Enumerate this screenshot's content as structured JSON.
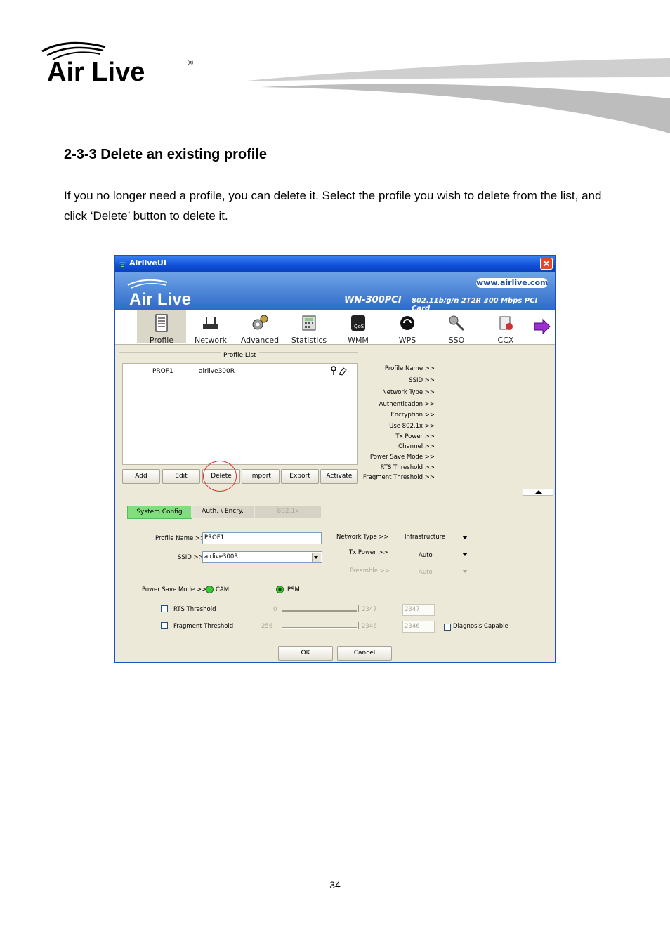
{
  "brand": {
    "name": "Air Live"
  },
  "section": {
    "heading": "2-3-3 Delete an existing profile",
    "body": "If you no longer need a profile, you can delete it. Select the profile you wish to delete from the list, and click ‘Delete’ button to delete it."
  },
  "page_number": "34",
  "window": {
    "title": "AirliveUI",
    "close_glyph": "✕",
    "banner": {
      "url": "www.airlive.com",
      "model": "WN-300PCI",
      "spec": "802.11b/g/n 2T2R 300 Mbps PCI Card"
    },
    "toolbar": [
      {
        "label": "Profile",
        "icon": "profile-icon"
      },
      {
        "label": "Network",
        "icon": "network-icon"
      },
      {
        "label": "Advanced",
        "icon": "advanced-icon"
      },
      {
        "label": "Statistics",
        "icon": "statistics-icon"
      },
      {
        "label": "WMM",
        "icon": "wmm-icon"
      },
      {
        "label": "WPS",
        "icon": "wps-icon"
      },
      {
        "label": "SSO",
        "icon": "sso-icon"
      },
      {
        "label": "CCX",
        "icon": "ccx-icon"
      }
    ],
    "profile_list": {
      "title": "Profile List",
      "rows": [
        {
          "name": "PROF1",
          "ssid": "airlive300R"
        }
      ],
      "buttons": [
        "Add",
        "Edit",
        "Delete",
        "Import",
        "Export",
        "Activate"
      ]
    },
    "profile_info": [
      "Profile Name >>",
      "SSID >>",
      "Network Type >>",
      "Authentication >>",
      "Encryption >>",
      "Use 802.1x >>",
      "Tx Power >>",
      "Channel >>",
      "Power Save Mode >>",
      "RTS Threshold >>",
      "Fragment Threshold >>"
    ],
    "tabs": [
      "System Config",
      "Auth. \\ Encry.",
      "802.1x"
    ],
    "config": {
      "profile_name_label": "Profile Name >>",
      "profile_name_value": "PROF1",
      "ssid_label": "SSID >>",
      "ssid_value": "airlive300R",
      "network_type_label": "Network Type >>",
      "network_type_value": "Infrastructure",
      "tx_power_label": "Tx Power >>",
      "tx_power_value": "Auto",
      "preamble_label": "Preamble >>",
      "preamble_value": "Auto",
      "power_save_label": "Power Save Mode >>",
      "cam_label": "CAM",
      "psm_label": "PSM",
      "rts_label": "RTS Threshold",
      "rts_min": "0",
      "rts_max": "2347",
      "rts_value": "2347",
      "frag_label": "Fragment Threshold",
      "frag_min": "256",
      "frag_max": "2346",
      "frag_value": "2346",
      "diagnosis_label": "Diagnosis Capable",
      "ok_label": "OK",
      "cancel_label": "Cancel"
    },
    "colors": {
      "selected_tab": "#7de07d",
      "highlight_circle": "#e03030",
      "banner_blue": "#2d6ac9"
    }
  }
}
